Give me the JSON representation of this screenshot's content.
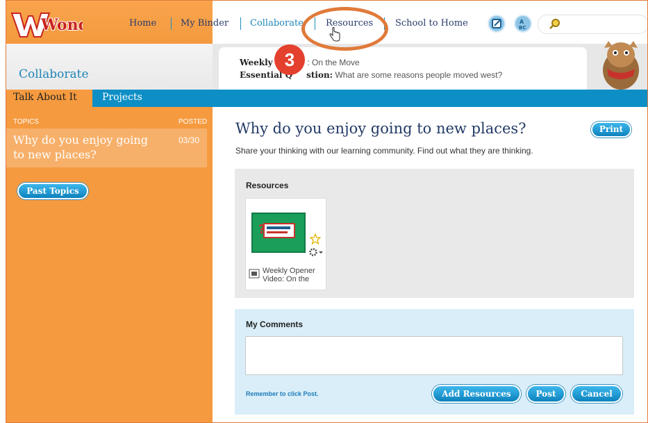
{
  "app": {
    "logo_text": "Wonders",
    "section_title": "Collaborate"
  },
  "nav": {
    "items": [
      "Home",
      "My Binder",
      "Collaborate",
      "Resources",
      "School to Home"
    ],
    "icons": [
      "notebook-icon",
      "abc-icon",
      "search-icon"
    ]
  },
  "header": {
    "weekly_label": "Weekly C",
    "weekly_value": ": On the Move",
    "essential_label": "Essential Q",
    "essential_label_end": "stion:",
    "essential_value": "What are some reasons people moved west?"
  },
  "annotation": {
    "step_number": "3"
  },
  "subtabs": [
    "Talk About It",
    "Projects"
  ],
  "topics": {
    "header_topics": "TOPICS",
    "header_posted": "POSTED",
    "items": [
      {
        "title": "Why do you enjoy going to new places?",
        "posted": "03/30"
      }
    ],
    "past_topics_label": "Past Topics"
  },
  "main": {
    "title": "Why do you enjoy going to new places?",
    "print_label": "Print",
    "intro": "Share your thinking with our learning community. Find out what they are thinking.",
    "resources": {
      "label": "Resources",
      "items": [
        {
          "caption_line1": "Weekly Opener",
          "caption_line2": "Video: On the"
        }
      ]
    },
    "comments": {
      "label": "My Comments",
      "placeholder": "",
      "reminder": "Remember to click Post.",
      "buttons": [
        "Add Resources",
        "Post",
        "Cancel"
      ]
    }
  },
  "colors": {
    "orange": "#f59a3f",
    "blue": "#0d8fc6",
    "annotation_red": "#e4402e",
    "annotation_ring": "#e07a3a"
  }
}
